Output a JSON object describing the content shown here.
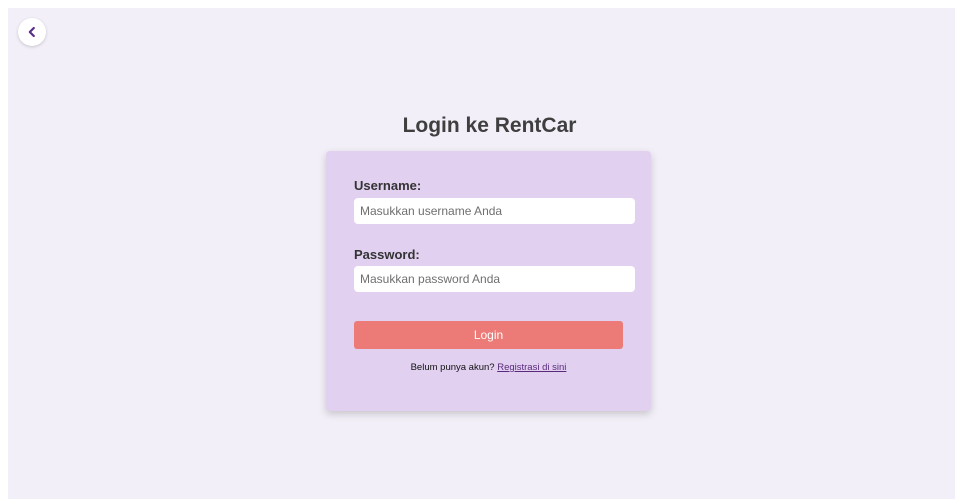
{
  "back_button": {
    "icon": "chevron-left-icon",
    "color": "#5b2d8a"
  },
  "title": "Login ke RentCar",
  "form": {
    "username": {
      "label": "Username:",
      "placeholder": "Masukkan username Anda",
      "value": ""
    },
    "password": {
      "label": "Password:",
      "placeholder": "Masukkan password Anda",
      "value": ""
    },
    "submit_label": "Login",
    "register_prompt": "Belum punya akun?",
    "register_link": "Registrasi di sini"
  },
  "colors": {
    "background": "#f3eff8",
    "card": "#e1d0f0",
    "button": "#ec7b78",
    "link": "#5a2a7a"
  }
}
